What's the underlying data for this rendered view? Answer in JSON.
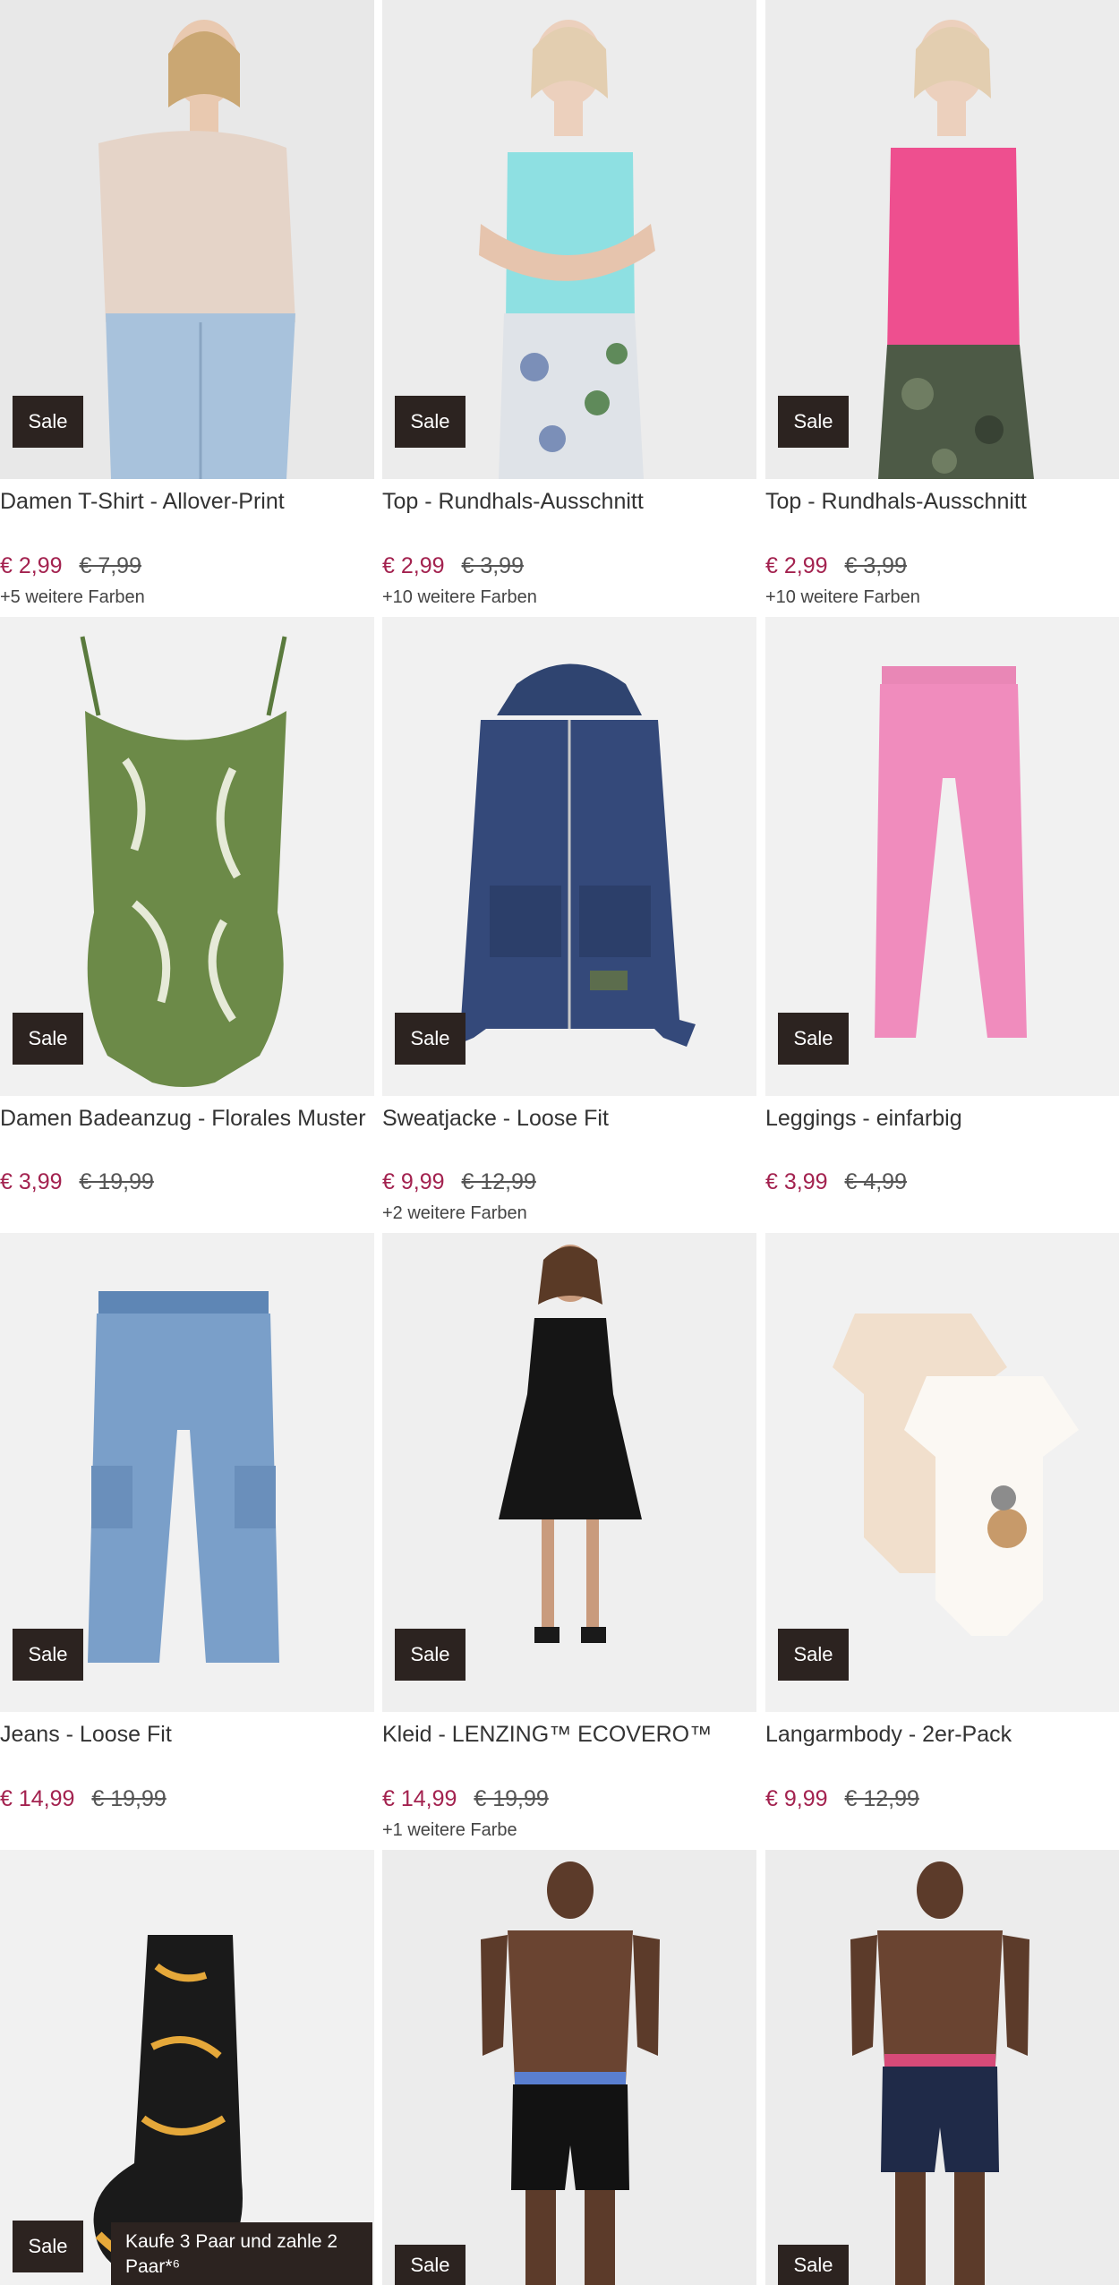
{
  "badges": {
    "sale": "Sale",
    "promo": "Kaufe 3 Paar und zahle 2 Paar*⁶"
  },
  "colors": {
    "accent_price": "#a3224f",
    "badge_bg": "#2c2320"
  },
  "products": [
    {
      "title": "Damen T-Shirt - Allover-Print",
      "price": "€ 2,99",
      "old_price": "€ 7,99",
      "colors_note": "+5 weitere Farben"
    },
    {
      "title": "Top - Rundhals-Ausschnitt",
      "price": "€ 2,99",
      "old_price": "€ 3,99",
      "colors_note": "+10 weitere Farben"
    },
    {
      "title": "Top - Rundhals-Ausschnitt",
      "price": "€ 2,99",
      "old_price": "€ 3,99",
      "colors_note": "+10 weitere Farben"
    },
    {
      "title": "Damen Badeanzug - Florales Muster",
      "price": "€ 3,99",
      "old_price": "€ 19,99",
      "colors_note": ""
    },
    {
      "title": "Sweatjacke - Loose Fit",
      "price": "€ 9,99",
      "old_price": "€ 12,99",
      "colors_note": "+2 weitere Farben"
    },
    {
      "title": "Leggings - einfarbig",
      "price": "€ 3,99",
      "old_price": "€ 4,99",
      "colors_note": ""
    },
    {
      "title": "Jeans - Loose Fit",
      "price": "€ 14,99",
      "old_price": "€ 19,99",
      "colors_note": ""
    },
    {
      "title": "Kleid - LENZING™ ECOVERO™",
      "price": "€ 14,99",
      "old_price": "€ 19,99",
      "colors_note": "+1 weitere Farbe"
    },
    {
      "title": "Langarmbody - 2er-Pack",
      "price": "€ 9,99",
      "old_price": "€ 12,99",
      "colors_note": ""
    },
    {
      "title": "",
      "price": "",
      "old_price": "",
      "colors_note": ""
    },
    {
      "title": "",
      "price": "",
      "old_price": "",
      "colors_note": ""
    },
    {
      "title": "",
      "price": "",
      "old_price": "",
      "colors_note": ""
    }
  ]
}
